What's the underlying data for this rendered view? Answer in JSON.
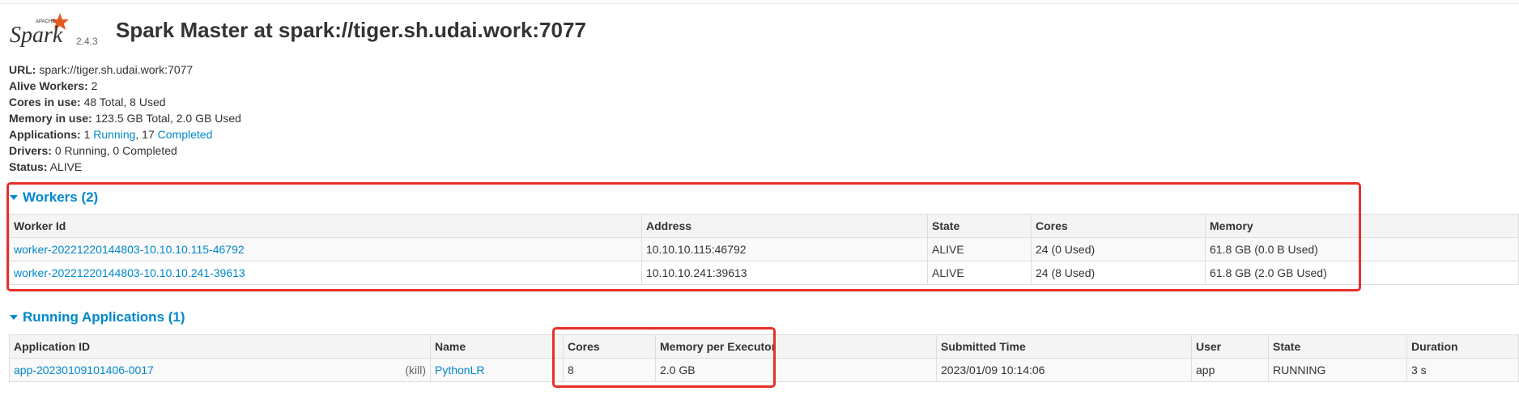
{
  "header": {
    "logo_text": "Spark",
    "logo_brand": "APACHE",
    "version": "2.4.3",
    "title": "Spark Master at spark://tiger.sh.udai.work:7077"
  },
  "summary": {
    "url_label": "URL:",
    "url_value": "spark://tiger.sh.udai.work:7077",
    "alive_workers_label": "Alive Workers:",
    "alive_workers_value": "2",
    "cores_label": "Cores in use:",
    "cores_value": "48 Total, 8 Used",
    "memory_label": "Memory in use:",
    "memory_value": "123.5 GB Total, 2.0 GB Used",
    "applications_label": "Applications:",
    "applications_running_count": "1",
    "applications_running_link": "Running",
    "applications_sep": ", 17",
    "applications_completed_link": "Completed",
    "drivers_label": "Drivers:",
    "drivers_value": "0 Running, 0 Completed",
    "status_label": "Status:",
    "status_value": "ALIVE"
  },
  "workers": {
    "title": "Workers (2)",
    "columns": [
      "Worker Id",
      "Address",
      "State",
      "Cores",
      "Memory"
    ],
    "rows": [
      [
        "worker-20221220144803-10.10.10.115-46792",
        "10.10.10.115:46792",
        "ALIVE",
        "24 (0 Used)",
        "61.8 GB (0.0 B Used)"
      ],
      [
        "worker-20221220144803-10.10.10.241-39613",
        "10.10.10.241:39613",
        "ALIVE",
        "24 (8 Used)",
        "61.8 GB (2.0 GB Used)"
      ]
    ]
  },
  "running_apps": {
    "title": "Running Applications (1)",
    "columns": [
      "Application ID",
      "Name",
      "Cores",
      "Memory per Executor",
      "Submitted Time",
      "User",
      "State",
      "Duration"
    ],
    "rows": [
      {
        "app_id": "app-20230109101406-0017",
        "kill": "(kill)",
        "name": "PythonLR",
        "cores": "8",
        "memory": "2.0 GB",
        "submitted": "2023/01/09 10:14:06",
        "user": "app",
        "state": "RUNNING",
        "duration": "3 s"
      }
    ]
  },
  "colors": {
    "link": "#0088cc",
    "highlight_box": "#e8302a",
    "logo_orange": "#e25a1c"
  }
}
